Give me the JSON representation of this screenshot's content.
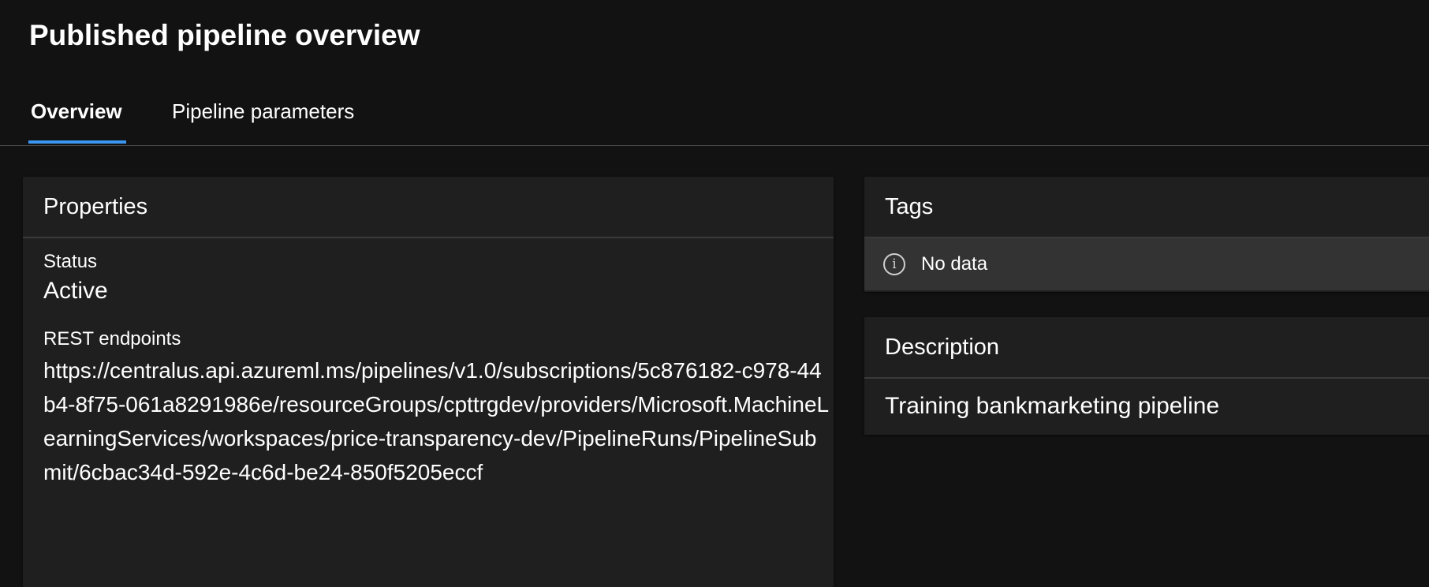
{
  "page": {
    "title": "Published pipeline overview"
  },
  "tabs": [
    {
      "label": "Overview",
      "active": true
    },
    {
      "label": "Pipeline parameters",
      "active": false
    }
  ],
  "properties": {
    "heading": "Properties",
    "status_label": "Status",
    "status_value": "Active",
    "endpoint_label": "REST endpoints",
    "endpoint_value": "https://centralus.api.azureml.ms/pipelines/v1.0/subscriptions/5c876182-c978-44b4-8f75-061a8291986e/resourceGroups/cpttrgdev/providers/Microsoft.MachineLearningServices/workspaces/price-transparency-dev/PipelineRuns/PipelineSubmit/6cbac34d-592e-4c6d-be24-850f5205eccf"
  },
  "tags": {
    "heading": "Tags",
    "empty_text": "No data",
    "icon": "info-icon"
  },
  "description": {
    "heading": "Description",
    "text": "Training bankmarketing pipeline"
  },
  "colors": {
    "accent": "#3a96f0",
    "background": "#121212",
    "card": "#1f1f1f"
  }
}
